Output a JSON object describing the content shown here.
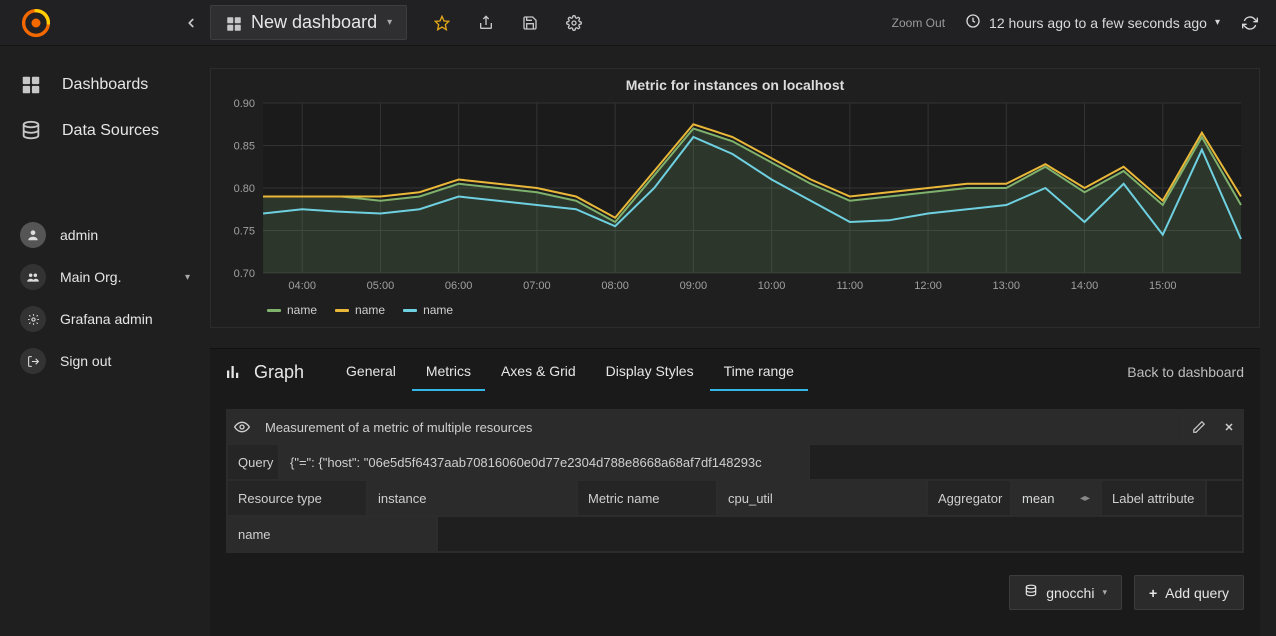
{
  "header": {
    "dashboard_label": "New dashboard",
    "zoom_out": "Zoom Out",
    "timerange": "12 hours ago to a few seconds ago"
  },
  "sidebar": {
    "items": [
      {
        "label": "Dashboards"
      },
      {
        "label": "Data Sources"
      }
    ],
    "user": {
      "label": "admin"
    },
    "org": {
      "label": "Main Org."
    },
    "admin": {
      "label": "Grafana admin"
    },
    "signout": {
      "label": "Sign out"
    }
  },
  "panel": {
    "title": "Metric for instances on localhost",
    "legend": [
      {
        "label": "name",
        "color": "#7EB26D"
      },
      {
        "label": "name",
        "color": "#EAB839"
      },
      {
        "label": "name",
        "color": "#6ED0E0"
      }
    ]
  },
  "chart_data": {
    "type": "line",
    "xlabel": "",
    "ylabel": "",
    "ylim": [
      0.7,
      0.9
    ],
    "y_ticks": [
      0.7,
      0.75,
      0.8,
      0.85,
      0.9
    ],
    "x_ticks": [
      "04:00",
      "05:00",
      "06:00",
      "07:00",
      "08:00",
      "09:00",
      "10:00",
      "11:00",
      "12:00",
      "13:00",
      "14:00",
      "15:00"
    ],
    "categories": [
      "03:30",
      "04:00",
      "04:30",
      "05:00",
      "05:30",
      "06:00",
      "06:30",
      "07:00",
      "07:30",
      "08:00",
      "08:30",
      "09:00",
      "09:30",
      "10:00",
      "10:30",
      "11:00",
      "11:30",
      "12:00",
      "12:30",
      "13:00",
      "13:30",
      "14:00",
      "14:30",
      "15:00",
      "15:20",
      "15:30"
    ],
    "series": [
      {
        "name": "name",
        "color": "#7EB26D",
        "fill": true,
        "values": [
          0.79,
          0.79,
          0.79,
          0.785,
          0.79,
          0.805,
          0.8,
          0.795,
          0.785,
          0.76,
          0.815,
          0.87,
          0.855,
          0.83,
          0.805,
          0.785,
          0.79,
          0.795,
          0.8,
          0.8,
          0.825,
          0.795,
          0.82,
          0.78,
          0.86,
          0.78
        ]
      },
      {
        "name": "name",
        "color": "#EAB839",
        "fill": false,
        "values": [
          0.79,
          0.79,
          0.79,
          0.79,
          0.795,
          0.81,
          0.805,
          0.8,
          0.79,
          0.765,
          0.82,
          0.875,
          0.86,
          0.835,
          0.81,
          0.79,
          0.795,
          0.8,
          0.805,
          0.805,
          0.828,
          0.8,
          0.825,
          0.785,
          0.865,
          0.79
        ]
      },
      {
        "name": "name",
        "color": "#6ED0E0",
        "fill": false,
        "values": [
          0.77,
          0.775,
          0.772,
          0.77,
          0.775,
          0.79,
          0.785,
          0.78,
          0.775,
          0.755,
          0.8,
          0.86,
          0.84,
          0.81,
          0.785,
          0.76,
          0.762,
          0.77,
          0.775,
          0.78,
          0.8,
          0.76,
          0.805,
          0.745,
          0.845,
          0.74
        ]
      }
    ]
  },
  "editor": {
    "title": "Graph",
    "tabs": [
      {
        "label": "General"
      },
      {
        "label": "Metrics"
      },
      {
        "label": "Axes & Grid"
      },
      {
        "label": "Display Styles"
      },
      {
        "label": "Time range"
      }
    ],
    "active_tab": 1,
    "secondary_active_tab": 4,
    "back_label": "Back to dashboard",
    "query": {
      "description": "Measurement of a metric of multiple resources",
      "query_label": "Query",
      "query_value": "{\"=\": {\"host\": \"06e5d5f6437aab70816060e0d77e2304d788e8668a68af7df148293c",
      "resource_type_label": "Resource type",
      "resource_type_value": "instance",
      "metric_name_label": "Metric name",
      "metric_name_value": "cpu_util",
      "aggregator_label": "Aggregator",
      "aggregator_value": "mean",
      "label_attr_label": "Label attribute",
      "label_attr_value": "name"
    },
    "footer": {
      "datasource": "gnocchi",
      "add_query": "Add query"
    }
  }
}
